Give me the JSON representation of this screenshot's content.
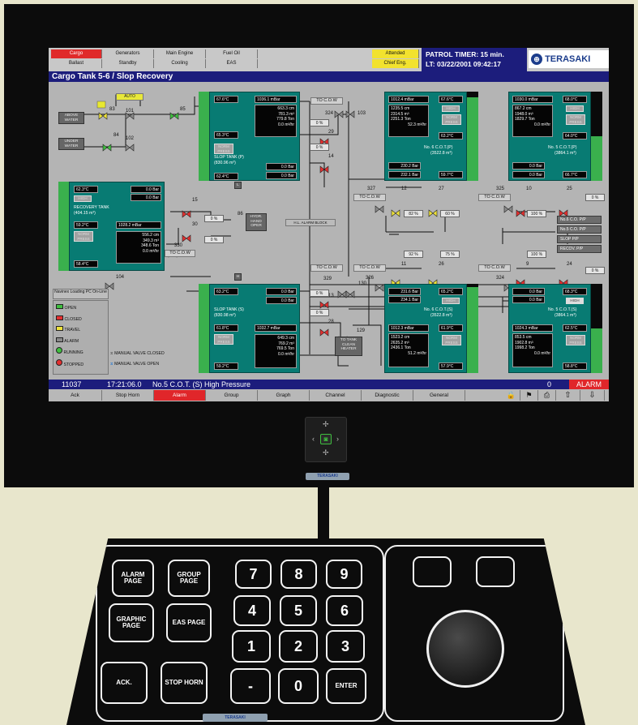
{
  "top_tabs": {
    "row1": [
      "Cargo",
      "Generators",
      "Main Engine",
      "Fuel Oil"
    ],
    "row2": [
      "Ballast",
      "Standby",
      "Cooling",
      "EAS"
    ],
    "attended": "Attended",
    "chief_eng": "Chief Eng.",
    "patrol_timer": "PATROL TIMER: 15  min.",
    "lt": "LT: 03/22/2001  09:42:17",
    "logo": "TERASAKI"
  },
  "page_title": "Cargo Tank 5-6 / Slop Recovery",
  "auto": "AUTO",
  "above_water": "ABOVE WATER",
  "under_water": "UNDER WATER",
  "valve_nums": {
    "v83": "83",
    "v101": "101",
    "v85": "85",
    "v84": "84",
    "v102": "102",
    "v103": "103",
    "v324": "324",
    "v29": "29",
    "v14": "14",
    "v15": "15",
    "v30": "30",
    "v330": "330",
    "v104": "104",
    "v86": "86",
    "v129": "129",
    "v13": "13",
    "v28": "28",
    "v130": "130",
    "v329": "329",
    "v327": "327",
    "v12": "12",
    "v27": "27",
    "v325": "325",
    "v10": "10",
    "v25": "25",
    "v326": "326",
    "v11": "11",
    "v26": "26",
    "v324b": "324",
    "v9": "9",
    "v24": "24"
  },
  "slop_p": {
    "temp1": "67.6°C",
    "press": "1036.1 mBar",
    "lvl": "663.3 cm",
    "vol": "781.3 m³",
    "ton": "779.8 Ton",
    "flow": "0.0 m³/hr",
    "high": "HIGH",
    "temp2": "65.3°C",
    "norm": "NORM PRESS",
    "title": "SLOP TANK (P)",
    "cap": "(830.96 m³)",
    "b1": "0.0 Bar",
    "b2": "0.0 Bar",
    "temp3": "62.4°C"
  },
  "slop_s": {
    "temp1": "63.2°C",
    "b1": "0.0 Bar",
    "b2": "0.0 Bar",
    "title": "SLOP TANK (S)",
    "cap": "(830.98 m³)",
    "temp2": "61.8°C",
    "press": "1032.7 mBar",
    "norm": "NORM PRESS",
    "lvl": "649.3 cm",
    "vol": "769.2 m³",
    "ton": "769.5 Ton",
    "flow": "0.0 m³/hr",
    "temp3": "59.2°C"
  },
  "recovery": {
    "temp1": "62.3°C",
    "b1": "0.0 Bar",
    "b2": "0.0 Bar",
    "high": "HIGH",
    "title": "RECOVERY TANK",
    "cap": "(404.15 m³)",
    "temp2": "59.2°C",
    "press": "1028.2 mBar",
    "norm": "NORM PRESS",
    "lvl": "556.2 cm",
    "vol": "349.3 m³",
    "ton": "348.6 Ton",
    "flow": "0.0 m³/hr",
    "temp3": "58.4°C"
  },
  "cot6p": {
    "press": "1012.4 mBar",
    "temp1": "67.6°C",
    "lvl": "1235.5 cm",
    "vol": "2314.5 m³",
    "ton": "2251.3 Ton",
    "flow": "52.3 m³/hr",
    "high": "HIGH",
    "norm": "NORM PRESS",
    "temp2": "63.2°C",
    "title": "No. 6 C.O.T.(P)",
    "cap": "(3522.8 m³)",
    "b1": "230.2 Bar",
    "b2": "232.1 Bar",
    "temp3": "59.7°C"
  },
  "cot5p": {
    "press": "1030.0 mBar",
    "temp1": "68.0°C",
    "lvl": "867.2 cm",
    "vol": "1948.0 m³",
    "ton": "1829.7 Ton",
    "flow": "0.0 m³/hr",
    "high": "HIGH",
    "norm": "NORM PRESS",
    "temp2": "64.0°C",
    "title": "No. 5 C.O.T.(P)",
    "cap": "(3864.1 m³)",
    "b1": "0.0 Bar",
    "b2": "0.0 Bar",
    "temp3": "66.7°C"
  },
  "cot6s": {
    "b1": "231.6 Bar",
    "b2": "234.1 Bar",
    "temp1": "65.2°C",
    "high": "HIGH",
    "title": "No. 6 C.O.T.(S)",
    "cap": "(3522.8 m³)",
    "press": "1012.3 mBar",
    "temp2": "61.9°C",
    "norm": "NORM PRESS",
    "lvl": "1523.2 cm",
    "vol": "2635.2 m³",
    "ton": "2436.1 Ton",
    "flow": "51.2 m³/hr",
    "temp3": "57.9°C"
  },
  "cot5s": {
    "b1": "0.0 Bar",
    "b2": "0.0 Bar",
    "temp1": "68.3°C",
    "high": "HIGH",
    "title": "No. 5 C.O.T.(S)",
    "cap": "(3864.1 m³)",
    "press": "1024.3 mBar",
    "temp2": "62.5°C",
    "norm": "NORM PRESS",
    "lvl": "853.5 cm",
    "vol": "1902.8 m³",
    "ton": "1998.2 Ton",
    "flow": "0.0 m³/hr",
    "temp3": "58.8°C"
  },
  "labels": {
    "to_cow": "TO C.O.W",
    "hydr": "HYDR. HAND OPER",
    "alarm_block": "H.L. ALARM BLOCK",
    "to_tank": "TO TANK CLEAN HEATER",
    "L": "L",
    "H": "H",
    "no6_pp": "No.6 C.O. P/P",
    "no5_pp": "No.5 C.O. P/P",
    "slop_pp": "SLOP P/P",
    "recov_pp": "RECOV. P/P"
  },
  "pcts": {
    "p0a": "0 %",
    "p0b": "0 %",
    "p0c": "0 %",
    "p0d": "0 %",
    "p0e": "0 %",
    "p0f": "0 %",
    "p0g": "0 %",
    "p0h": "0 %",
    "p0i": "0 %",
    "p0j": "0 %",
    "p82": "82 %",
    "p60": "60 %",
    "p100a": "100 %",
    "p92": "92 %",
    "p75": "75 %",
    "p100b": "100 %"
  },
  "legend": {
    "header": "Navinex Loading PC On-Line",
    "open": "OPEN",
    "closed": "CLOSED",
    "travel": "TRAVEL",
    "alarm": "ALARM",
    "running": "RUNNING",
    "stopped": "STOPPED",
    "manual_closed": "MANUAL VALVE CLOSED",
    "manual_open": "MANUAL VALVE OPEN"
  },
  "status": {
    "code": "11037",
    "time": "17:21:06.0",
    "message": "No.5 C.O.T. (S) High Pressure",
    "count": "0",
    "alarm": "ALARM"
  },
  "softkeys": [
    "Ack",
    "Stop Horn",
    "Alarm",
    "Group",
    "Graph",
    "Channel",
    "Diagnostic",
    "General"
  ],
  "bezel_logo": "TERASAKI",
  "keypad": {
    "alarm_page": "ALARM PAGE",
    "group_page": "GROUP PAGE",
    "graphic_page": "GRAPHIC PAGE",
    "eas_page": "EAS PAGE",
    "ack": "ACK.",
    "stop_horn": "STOP HORN",
    "k7": "7",
    "k8": "8",
    "k9": "9",
    "k4": "4",
    "k5": "5",
    "k6": "6",
    "k1": "1",
    "k2": "2",
    "k3": "3",
    "kdot": "-",
    "k0": "0",
    "enter": "ENTER",
    "logo": "TERASAKI"
  },
  "colors": {
    "tank_teal": "#087b73",
    "title_blue": "#1c1d7c",
    "alarm_red": "#e0262a",
    "level_green": "#3ab04d",
    "attended_yellow": "#f2e22e"
  }
}
